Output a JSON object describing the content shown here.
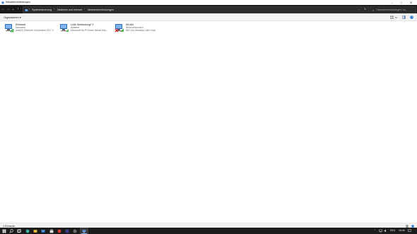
{
  "window": {
    "title": "Netzwerkverbindungen",
    "controls": {
      "minimize": "–",
      "maximize": "□",
      "close": "✕"
    }
  },
  "nav": {
    "back": "←",
    "forward": "→",
    "recent": "⌄",
    "up": "↑",
    "breadcrumb": [
      "Systemsteuerung",
      "Netzwerk und Internet",
      "Netzwerkverbindungen"
    ],
    "separator": "›",
    "search_placeholder": "\"Netzwerkverbindungen\" du..."
  },
  "toolbar": {
    "organize": "Organisieren"
  },
  "connections": [
    {
      "name": "Ethernet",
      "status": "Netzwerk",
      "device": "Intel(R) Ethernet Connection I217-V",
      "icon": "ethernet-adapter-icon",
      "disconnected": false
    },
    {
      "name": "LAN-Verbindung* 2",
      "status": "Aktiviert",
      "device": "Microsoft Wi-Fi Direct Virtual Ada...",
      "icon": "virtual-adapter-icon",
      "disconnected": false
    },
    {
      "name": "WLAN",
      "status": "Nicht verbunden",
      "device": "802.11n Wireless LAN Card",
      "icon": "wlan-adapter-icon",
      "disconnected": true
    }
  ],
  "status_bar": {
    "count": "3 Elemente"
  },
  "tray": {
    "lang": "DEU",
    "time": "18:46"
  },
  "colors": {
    "accent": "#1e73d8",
    "dark_bar": "#191919",
    "taskbar": "#1c1c1c"
  }
}
